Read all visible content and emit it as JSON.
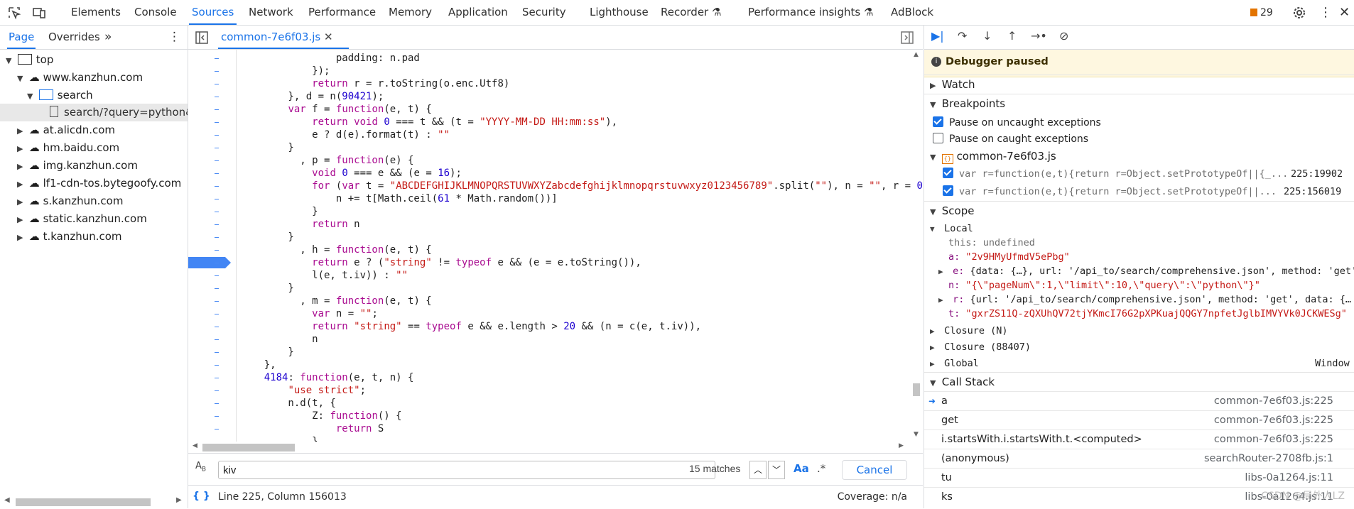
{
  "topbar": {
    "tabs": [
      "Elements",
      "Console",
      "Sources",
      "Network",
      "Performance",
      "Memory",
      "Application",
      "Security",
      "Lighthouse",
      "Recorder",
      "Performance insights",
      "AdBlock"
    ],
    "active_tab": "Sources",
    "issues_count": "29"
  },
  "left": {
    "tabs": [
      "Page",
      "Overrides"
    ],
    "tree": [
      {
        "label": "top",
        "indent": 0
      },
      {
        "label": "www.kanzhun.com",
        "indent": 1
      },
      {
        "label": "search",
        "indent": 2
      },
      {
        "label": "search/?query=python&t",
        "indent": 3
      },
      {
        "label": "at.alicdn.com",
        "indent": 1
      },
      {
        "label": "hm.baidu.com",
        "indent": 1
      },
      {
        "label": "img.kanzhun.com",
        "indent": 1
      },
      {
        "label": "lf1-cdn-tos.bytegoofy.com",
        "indent": 1
      },
      {
        "label": "s.kanzhun.com",
        "indent": 1
      },
      {
        "label": "static.kanzhun.com",
        "indent": 1
      },
      {
        "label": "t.kanzhun.com",
        "indent": 1
      }
    ]
  },
  "editor": {
    "tab_label": "common-7e6f03.js",
    "code": [
      "                padding: n.pad",
      "            });",
      "            return r = r.toString(o.enc.Utf8)",
      "        }, d = n(90421);",
      "        var f = function(e, t) {",
      "            return void 0 === t && (t = \"YYYY-MM-DD HH:mm:ss\"),",
      "            e ? d(e).format(t) : \"\"",
      "        }",
      "          , p = function(e) {",
      "            void 0 === e && (e = 16);",
      "            for (var t = \"ABCDEFGHIJKLMNOPQRSTUVWXYZabcdefghijklmnopqrstuvwxyz0123456789\".split(\"\"), n = \"\", r = 0",
      "                n += t[Math.ceil(61 * Math.random())]",
      "            }",
      "            return n",
      "        }",
      "          , h = function(e, t) {",
      "            return e ? (\"string\" != typeof e && (e = e.toString()),",
      "            l(e, t.iv)) : \"\"",
      "        }",
      "          , m = function(e, t) {",
      "            var n = \"\";",
      "            return \"string\" == typeof e && e.length > 20 && (n = c(e, t.iv)),",
      "            n",
      "        }",
      "    },",
      "    4184: function(e, t, n) {",
      "        \"use strict\";",
      "        n.d(t, {",
      "            Z: function() {",
      "                return S",
      "            }"
    ],
    "paused_line_index": 16,
    "search": {
      "value": "kiv",
      "matches": "15 matches",
      "case_label": "Aa",
      "regex_label": ".*",
      "cancel": "Cancel"
    },
    "status": {
      "position": "Line 225, Column 156013",
      "coverage": "Coverage: n/a"
    }
  },
  "right": {
    "paused_label": "Debugger paused",
    "sections": {
      "watch": "Watch",
      "breakpoints": "Breakpoints",
      "scope": "Scope",
      "call_stack": "Call Stack"
    },
    "exceptions": [
      {
        "label": "Pause on uncaught exceptions",
        "checked": true
      },
      {
        "label": "Pause on caught exceptions",
        "checked": false
      }
    ],
    "bp_file": "common-7e6f03.js",
    "breakpoints": [
      {
        "code": "var r=function(e,t){return r=Object.setPrototypeOf||{_...",
        "loc": "225:19902"
      },
      {
        "code": "var r=function(e,t){return r=Object.setPrototypeOf||...",
        "loc": "225:156019"
      }
    ],
    "scope": {
      "local_label": "Local",
      "this_line": "this: undefined",
      "vars": [
        {
          "name": "a:",
          "value": "\"2v9HMyUfmdV5ePbg\"",
          "expand": false
        },
        {
          "name": "e:",
          "value": "{data: {…}, url: '/api_to/search/comprehensive.json', method: 'get'",
          "expand": true
        },
        {
          "name": "n:",
          "value": "\"{\\\"pageNum\\\":1,\\\"limit\\\":10,\\\"query\\\":\\\"python\\\"}\"",
          "expand": false
        },
        {
          "name": "r:",
          "value": "{url: '/api_to/search/comprehensive.json', method: 'get', data: {…",
          "expand": true
        },
        {
          "name": "t:",
          "value": "\"gxrZS11Q-zQXUhQV72tjYKmcI76G2pXPKuajQQGY7npfetJglbIMVYVk0JCKWESg\"",
          "expand": false
        }
      ],
      "groups": [
        {
          "label": "Closure (N)",
          "right": ""
        },
        {
          "label": "Closure (88407)",
          "right": ""
        },
        {
          "label": "Global",
          "right": "Window"
        }
      ]
    },
    "call_stack": [
      {
        "fn": "a",
        "loc": "common-7e6f03.js:225",
        "current": true
      },
      {
        "fn": "get",
        "loc": "common-7e6f03.js:225",
        "current": false
      },
      {
        "fn": "i.startsWith.i.startsWith.t.<computed>",
        "loc": "common-7e6f03.js:225",
        "current": false
      },
      {
        "fn": "(anonymous)",
        "loc": "searchRouter-2708fb.js:1",
        "current": false
      },
      {
        "fn": "tu",
        "loc": "libs-0a1264.js:11",
        "current": false
      },
      {
        "fn": "ks",
        "loc": "libs-0a1264.js:11",
        "current": false
      }
    ],
    "watermark": "CSDN @局外人LZ"
  }
}
